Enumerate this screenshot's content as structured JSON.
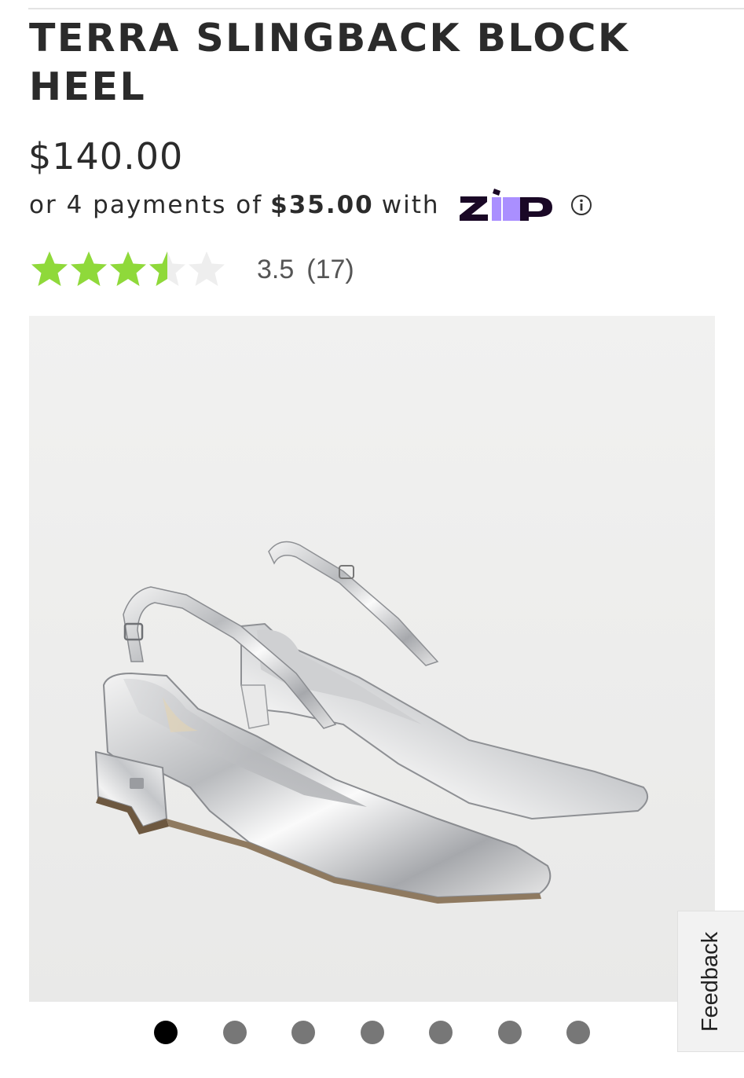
{
  "product": {
    "title": "TERRA SLINGBACK BLOCK HEEL",
    "price": "$140.00"
  },
  "financing": {
    "prefix": "or 4 payments of",
    "installment": "$35.00",
    "suffix": "with",
    "provider_logo": "zip-logo",
    "provider_logo_text": "ZiP",
    "info_icon": "info-icon"
  },
  "rating": {
    "value": 3.5,
    "value_text": "3.5",
    "count_text": "(17)",
    "max_stars": 5,
    "star_color": "#8fd93a",
    "empty_star_color": "#eeeeee"
  },
  "image": {
    "description_icon": "product-photo"
  },
  "carousel": {
    "slide_count": 7,
    "active_index": 0
  },
  "feedback": {
    "label": "Feedback"
  }
}
